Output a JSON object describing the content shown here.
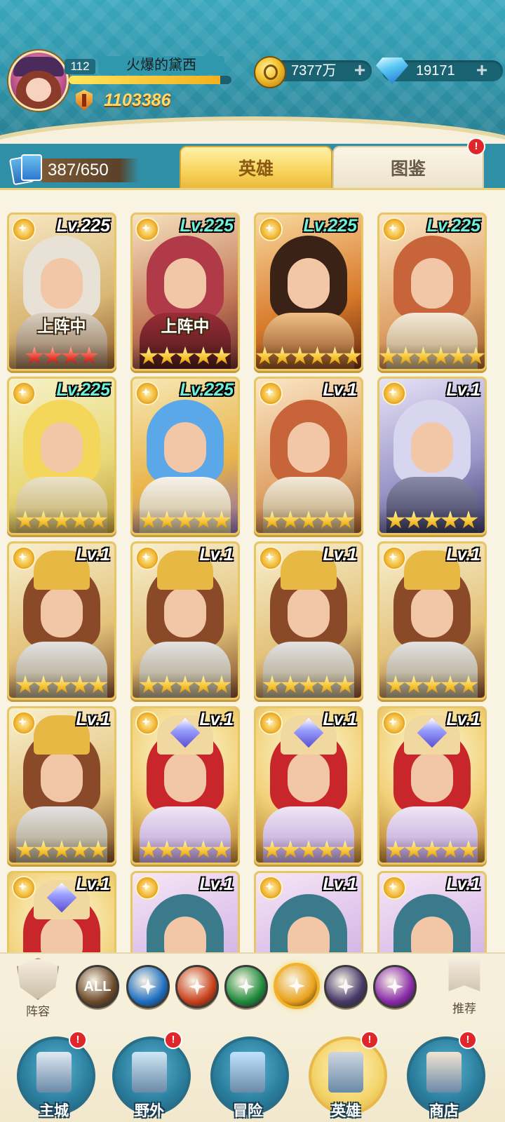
{
  "player": {
    "level": "112",
    "name": "火爆的黛西",
    "exp_fraction": 0.93,
    "power": "1103386"
  },
  "resources": {
    "gold": "7377万",
    "gems": "19171",
    "plus": "+"
  },
  "collection": {
    "count": "387/650"
  },
  "tabs": [
    {
      "label": "英雄",
      "active": true
    },
    {
      "label": "图鉴",
      "active": false,
      "alert": "!"
    }
  ],
  "hero_cards": [
    {
      "level": "Lv.225",
      "status": "上阵中",
      "stars": 4,
      "star_color": "red",
      "level_color": "low",
      "art": "elder-knight"
    },
    {
      "level": "Lv.225",
      "status": "上阵中",
      "stars": 5,
      "star_color": "gold",
      "level_color": "high",
      "art": "red-hood"
    },
    {
      "level": "Lv.225",
      "status": "",
      "stars": 6,
      "star_color": "gold",
      "level_color": "high",
      "art": "flame-warrior"
    },
    {
      "level": "Lv.225",
      "status": "",
      "stars": 6,
      "star_color": "gold",
      "level_color": "high",
      "art": "monkey-king"
    },
    {
      "level": "Lv.225",
      "status": "",
      "stars": 5,
      "star_color": "gold",
      "level_color": "high",
      "art": "blonde-girl"
    },
    {
      "level": "Lv.225",
      "status": "",
      "stars": 5,
      "star_color": "gold",
      "level_color": "high",
      "art": "blue-mage"
    },
    {
      "level": "Lv.1",
      "status": "",
      "stars": 5,
      "star_color": "gold",
      "level_color": "low",
      "art": "monkey-king"
    },
    {
      "level": "Lv.1",
      "status": "",
      "stars": 5,
      "star_color": "gold",
      "level_color": "low",
      "art": "silver-elf"
    },
    {
      "level": "Lv.1",
      "status": "",
      "stars": 5,
      "star_color": "gold",
      "level_color": "low",
      "art": "golden-paladin"
    },
    {
      "level": "Lv.1",
      "status": "",
      "stars": 5,
      "star_color": "gold",
      "level_color": "low",
      "art": "golden-paladin"
    },
    {
      "level": "Lv.1",
      "status": "",
      "stars": 5,
      "star_color": "gold",
      "level_color": "low",
      "art": "golden-paladin"
    },
    {
      "level": "Lv.1",
      "status": "",
      "stars": 5,
      "star_color": "gold",
      "level_color": "low",
      "art": "golden-paladin"
    },
    {
      "level": "Lv.1",
      "status": "",
      "stars": 5,
      "star_color": "gold",
      "level_color": "low",
      "art": "golden-paladin"
    },
    {
      "level": "Lv.1",
      "status": "",
      "stars": 5,
      "star_color": "gold",
      "level_color": "low",
      "art": "crystal-priestess"
    },
    {
      "level": "Lv.1",
      "status": "",
      "stars": 5,
      "star_color": "gold",
      "level_color": "low",
      "art": "crystal-priestess"
    },
    {
      "level": "Lv.1",
      "status": "",
      "stars": 5,
      "star_color": "gold",
      "level_color": "low",
      "art": "crystal-priestess"
    },
    {
      "level": "Lv.1",
      "status": "",
      "stars": 0,
      "star_color": "gold",
      "level_color": "low",
      "art": "crystal-priestess"
    },
    {
      "level": "Lv.1",
      "status": "",
      "stars": 0,
      "star_color": "gold",
      "level_color": "low",
      "art": "old-wizard"
    },
    {
      "level": "Lv.1",
      "status": "",
      "stars": 0,
      "star_color": "gold",
      "level_color": "low",
      "art": "old-wizard"
    },
    {
      "level": "Lv.1",
      "status": "",
      "stars": 0,
      "star_color": "gold",
      "level_color": "low",
      "art": "old-wizard"
    }
  ],
  "filters": {
    "lineup_label": "阵容",
    "recommend_label": "推荐",
    "factions": [
      {
        "label": "ALL",
        "icon": "all-icon",
        "color": "#6b4a2a"
      },
      {
        "label": "",
        "icon": "water-faction-icon",
        "color": "#1f6fc0"
      },
      {
        "label": "",
        "icon": "fire-faction-icon",
        "color": "#c8401a"
      },
      {
        "label": "",
        "icon": "wind-faction-icon",
        "color": "#1f8a3a"
      },
      {
        "label": "",
        "icon": "light-faction-icon",
        "color": "#e9a21c",
        "selected": true
      },
      {
        "label": "",
        "icon": "dark-faction-icon",
        "color": "#4a3a6a"
      },
      {
        "label": "",
        "icon": "void-faction-icon",
        "color": "#8a2aa8"
      }
    ]
  },
  "nav": [
    {
      "label": "主城",
      "icon": "castle-icon",
      "alert": "!"
    },
    {
      "label": "野外",
      "icon": "portal-icon",
      "alert": "!"
    },
    {
      "label": "冒险",
      "icon": "sword-icon",
      "alert": ""
    },
    {
      "label": "英雄",
      "icon": "helmet-icon",
      "alert": "!",
      "active": true
    },
    {
      "label": "商店",
      "icon": "shop-icon",
      "alert": "!"
    }
  ],
  "colors": {
    "level_high": "#6df0d8",
    "accent_gold": "#f3b22c",
    "alert_red": "#e0262a"
  }
}
